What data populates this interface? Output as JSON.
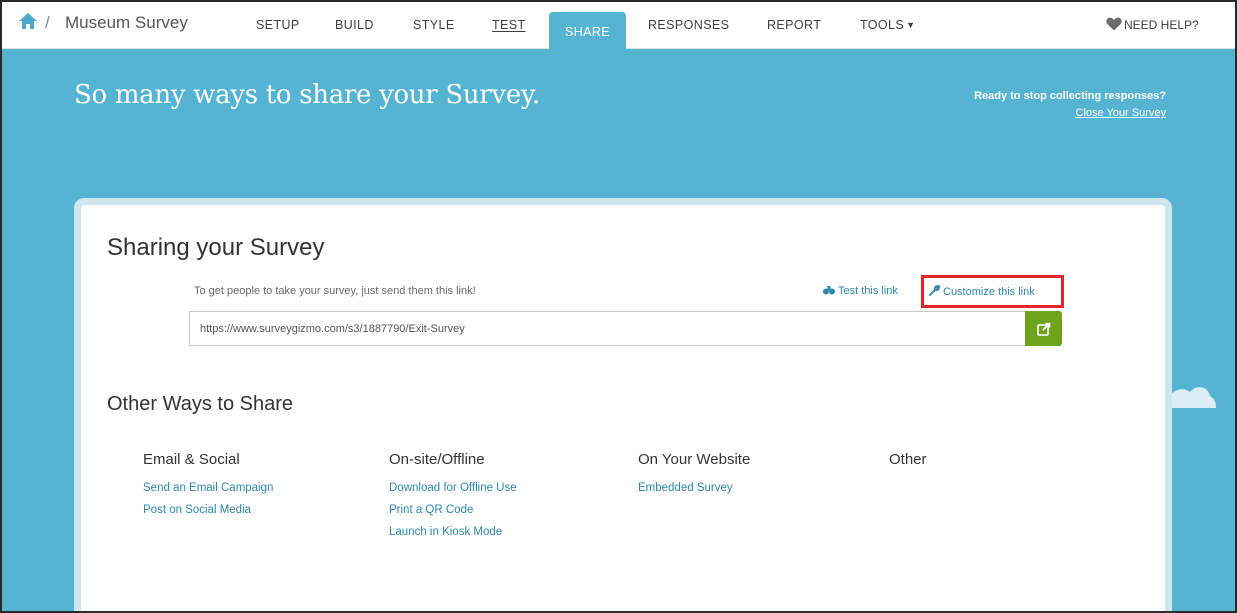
{
  "nav": {
    "app_title": "Museum Survey",
    "separator": "/",
    "items": [
      "SETUP",
      "BUILD",
      "STYLE",
      "TEST",
      "SHARE",
      "RESPONSES",
      "REPORT",
      "TOOLS"
    ],
    "need_help": "NEED HELP?",
    "active": "SHARE"
  },
  "hero": {
    "title": "So many ways to share your Survey.",
    "stop_text": "Ready to stop collecting responses?",
    "close_link": "Close Your Survey"
  },
  "card": {
    "title": "Sharing your Survey",
    "description": "To get people to take your survey, just send them this link!",
    "test_link": "Test this link",
    "customize_link": "Customize this link",
    "url": "https://www.surveygizmo.com/s3/1887790/Exit-Survey"
  },
  "other": {
    "title": "Other Ways to Share",
    "columns": [
      {
        "title": "Email & Social",
        "links": [
          "Send an Email Campaign",
          "Post on Social Media"
        ]
      },
      {
        "title": "On-site/Offline",
        "links": [
          "Download for Offline Use",
          "Print a QR Code",
          "Launch in Kiosk Mode"
        ]
      },
      {
        "title": "On Your Website",
        "links": [
          "Embedded Survey"
        ]
      },
      {
        "title": "Other",
        "links": []
      }
    ]
  },
  "colors": {
    "brand_blue": "#56b4d3",
    "link_blue": "#2f87ad",
    "action_green": "#6ea31a",
    "highlight_red": "#e8242b"
  }
}
